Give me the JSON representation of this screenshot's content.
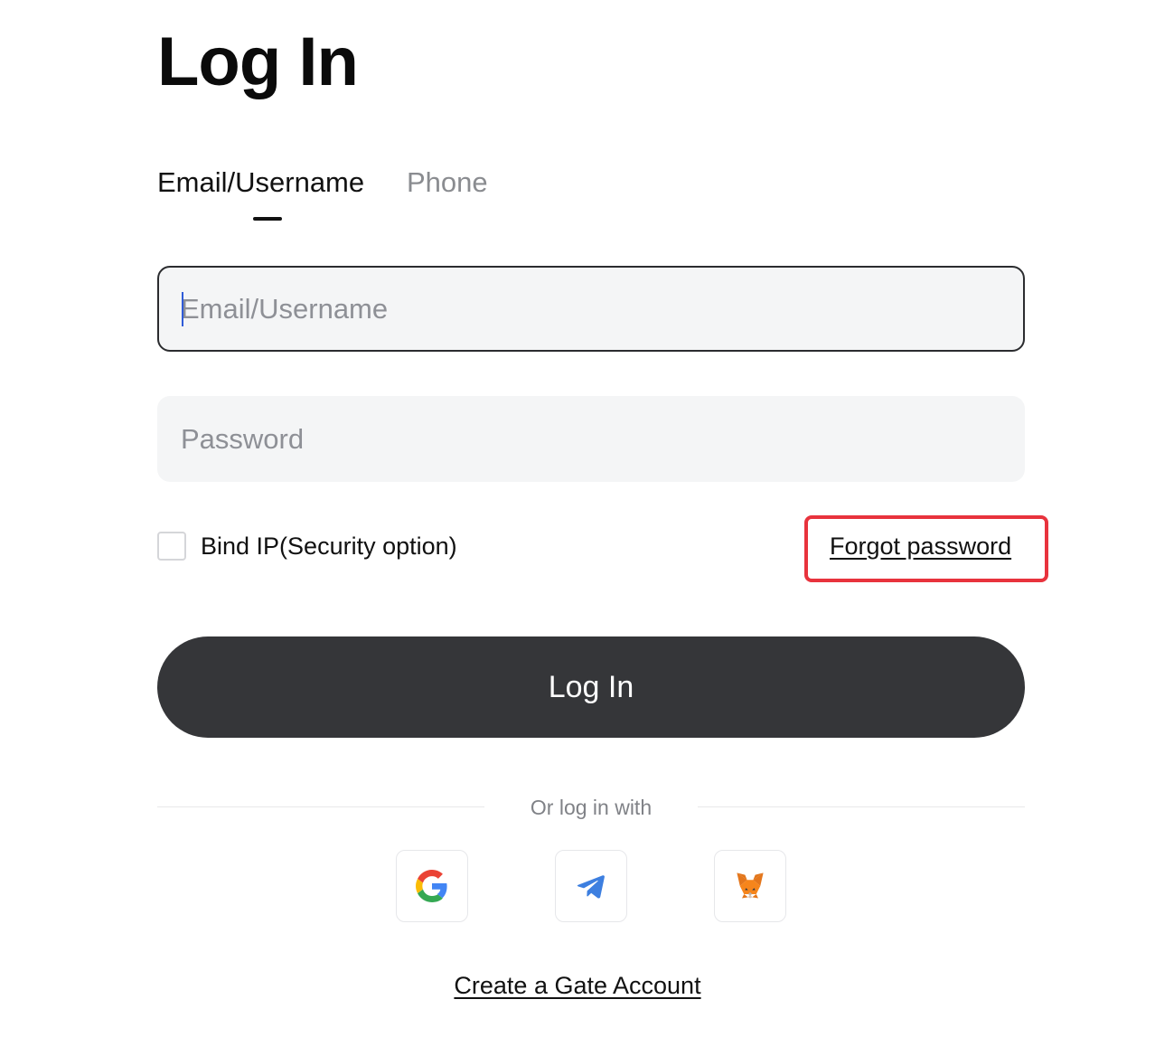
{
  "page": {
    "title": "Log In"
  },
  "tabs": [
    {
      "label": "Email/Username",
      "active": true
    },
    {
      "label": "Phone",
      "active": false
    }
  ],
  "form": {
    "email_placeholder": "Email/Username",
    "email_value": "",
    "password_placeholder": "Password",
    "password_value": "",
    "bind_ip_label": "Bind IP(Security option)",
    "bind_ip_checked": false,
    "forgot_label": "Forgot password",
    "submit_label": "Log In"
  },
  "social": {
    "divider_text": "Or log in with",
    "providers": [
      {
        "name": "Google",
        "icon": "google-icon"
      },
      {
        "name": "Telegram",
        "icon": "telegram-icon"
      },
      {
        "name": "MetaMask",
        "icon": "metamask-icon"
      }
    ]
  },
  "footer": {
    "create_account_label": "Create a Gate Account"
  },
  "colors": {
    "primary_button": "#353639",
    "highlight": "#e8333d",
    "input_bg": "#f4f5f6",
    "caret": "#2f5bd8"
  }
}
